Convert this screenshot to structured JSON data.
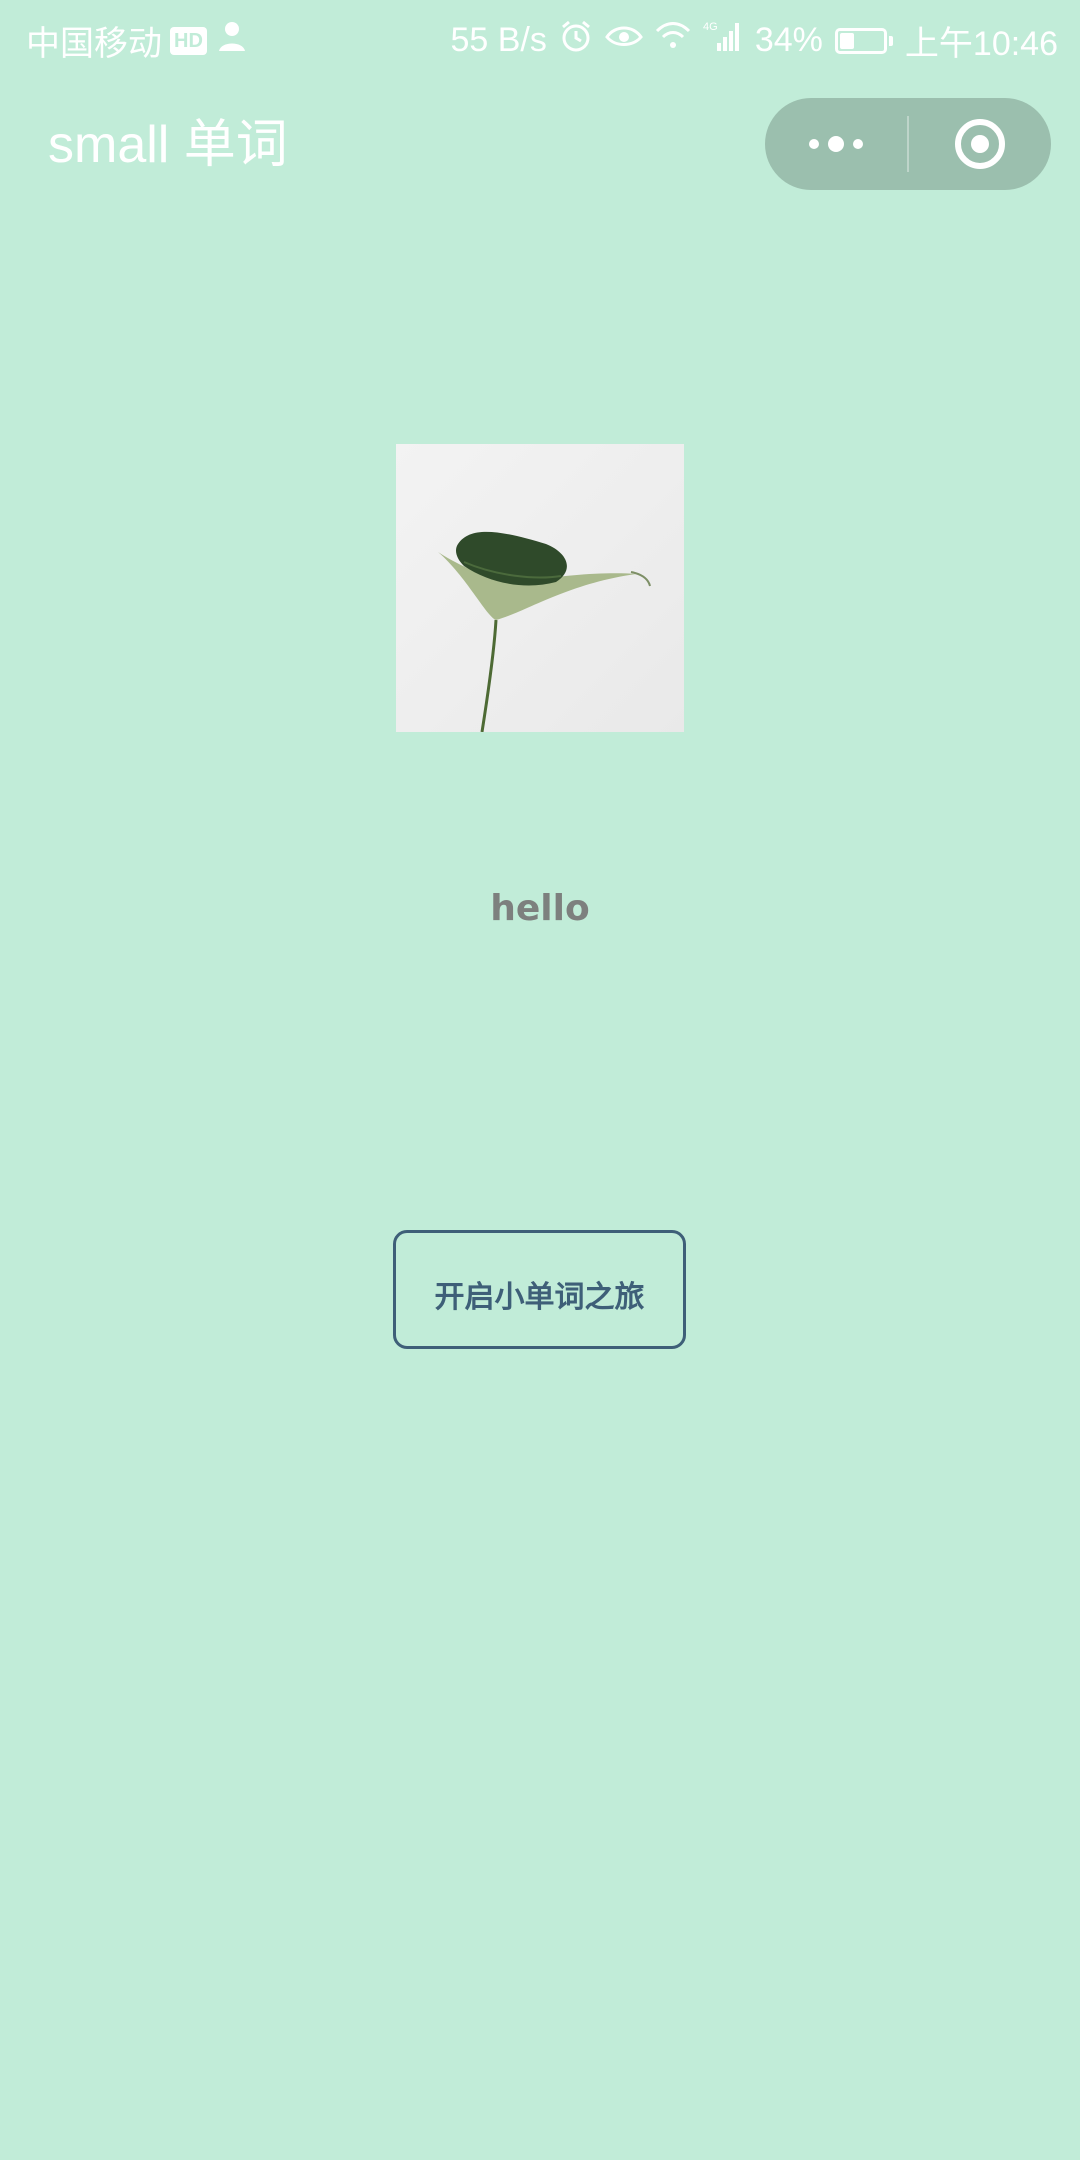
{
  "status_bar": {
    "carrier": "中国移动",
    "hd_badge": "HD",
    "speed": "55 B/s",
    "network": "4G",
    "battery_percent": "34%",
    "battery_level": 0.34,
    "time": "上午10:46"
  },
  "nav": {
    "title": "small 单词"
  },
  "main": {
    "image_name": "leaf-image",
    "greeting": "hello",
    "start_button_label": "开启小单词之旅"
  },
  "colors": {
    "background": "#c1ecd8",
    "button_border": "#3e5f78",
    "capsule": "#9bbfae",
    "greeting_text": "#7d807e"
  },
  "icons": [
    "alarm-icon",
    "eye-icon",
    "wifi-icon",
    "signal-icon",
    "battery-icon",
    "more-dots-icon",
    "close-target-icon"
  ]
}
